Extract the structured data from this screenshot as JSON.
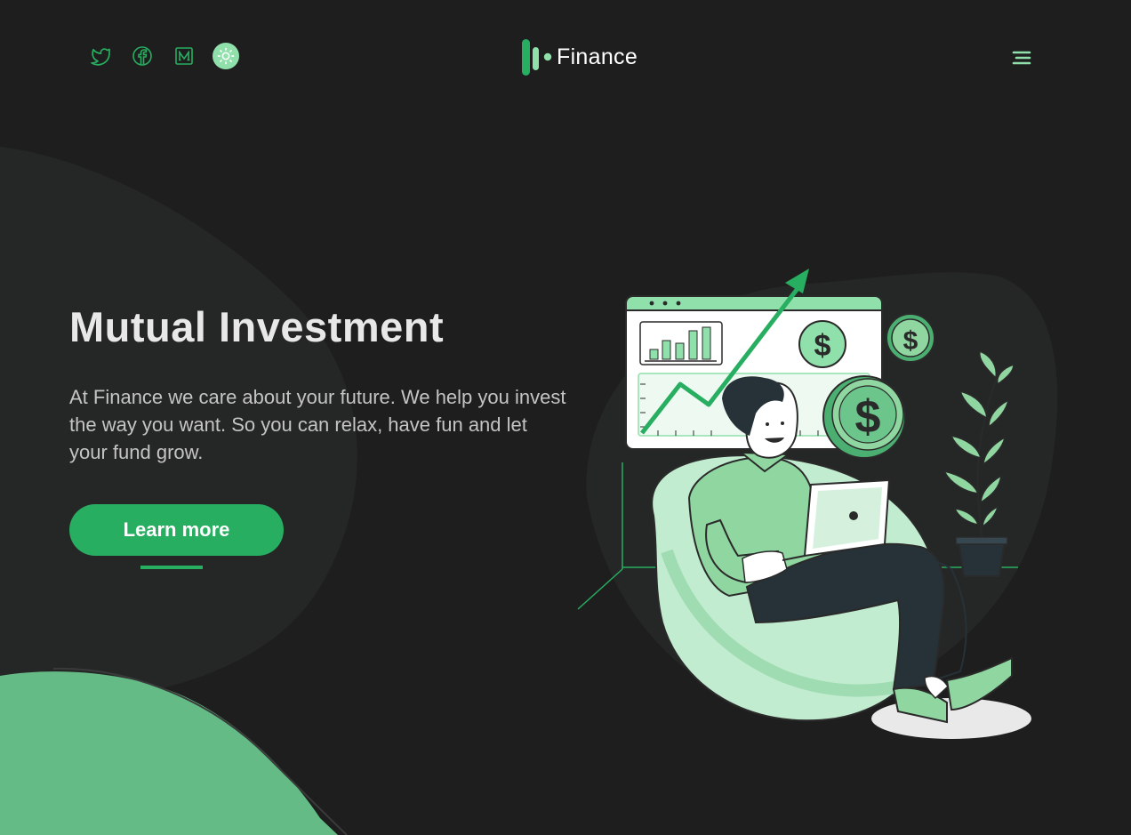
{
  "brand": {
    "name": "Finance",
    "accent": "#27ae60",
    "accent_light": "#8fe0ab"
  },
  "header": {
    "socials": [
      {
        "icon": "twitter-icon"
      },
      {
        "icon": "facebook-icon"
      },
      {
        "icon": "medium-icon"
      }
    ],
    "theme_toggle_icon": "sun-icon",
    "menu_icon": "hamburger-menu-icon"
  },
  "hero": {
    "title": "Mutual Investment",
    "description": "At Finance we care about your future. We help you invest the way you want. So you can relax, have fun and let your fund grow.",
    "cta_label": "Learn more"
  },
  "colors": {
    "background": "#1e1e1e",
    "blob": "#252727",
    "green_dark": "#27ae60",
    "green_mid": "#8fd6a0",
    "green_pale": "#c2ecd0"
  }
}
